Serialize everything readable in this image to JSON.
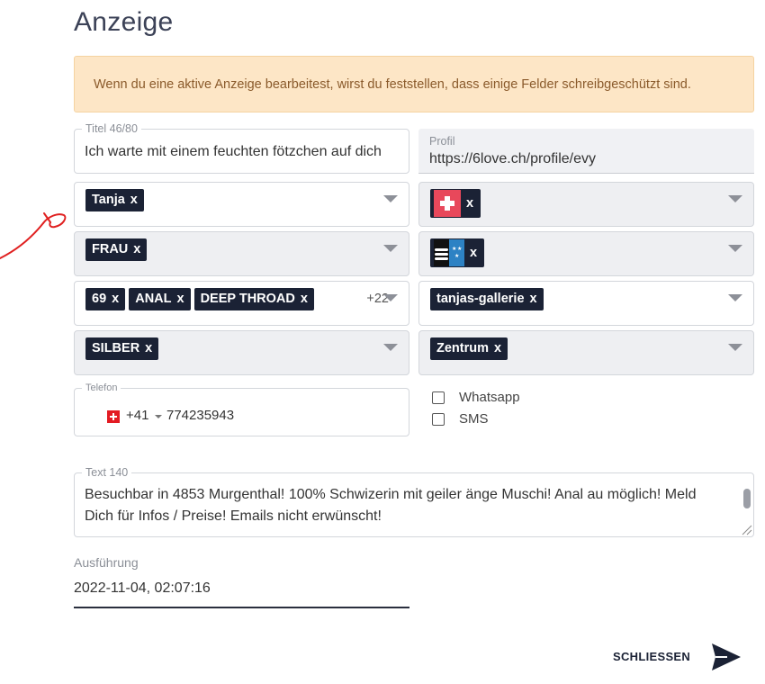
{
  "page": {
    "title": "Anzeige"
  },
  "alert": {
    "text": "Wenn du eine aktive Anzeige bearbeitest, wirst du feststellen, dass einige Felder schreibgeschützt sind."
  },
  "title_field": {
    "legend": "Titel 46/80",
    "value": "Ich warte mit einem feuchten fötzchen auf dich"
  },
  "profile_field": {
    "label": "Profil",
    "value": "https://6love.ch/profile/evy"
  },
  "selects": {
    "name": {
      "chips": [
        "Tanja"
      ]
    },
    "country": {
      "flag_icon": "switzerland-flag",
      "remove": "x"
    },
    "gender": {
      "chips": [
        "FRAU"
      ]
    },
    "canton": {
      "flag_icon": "aargau-flag",
      "remove": "x"
    },
    "services": {
      "chips": [
        "69",
        "ANAL",
        "DEEP THROAD"
      ],
      "more": "+22"
    },
    "gallery": {
      "chips": [
        "tanjas-gallerie"
      ]
    },
    "level": {
      "chips": [
        "SILBER"
      ]
    },
    "area": {
      "chips": [
        "Zentrum"
      ]
    },
    "chip_remove": "x"
  },
  "phone": {
    "legend": "Telefon",
    "flag_icon": "switzerland-flag",
    "country_code": "+41",
    "number": "774235943"
  },
  "contact_options": [
    {
      "label": "Whatsapp",
      "checked": false
    },
    {
      "label": "SMS",
      "checked": false
    }
  ],
  "text_field": {
    "legend": "Text 140",
    "value": "Besuchbar in 4853 Murgenthal! 100% Schwizerin mit geiler änge Muschi! Anal au möglich! Meld Dich für Infos / Preise! Emails nicht erwünscht!"
  },
  "execution": {
    "label": "Ausführung",
    "value": "2022-11-04, 02:07:16"
  },
  "actions": {
    "close_label": "SCHLIESSEN",
    "send_icon": "send-icon"
  },
  "colors": {
    "chip_bg": "#1b2235",
    "alert_bg": "#fde6c6",
    "alert_text": "#8a5a2b",
    "annotation": "#e02020"
  }
}
